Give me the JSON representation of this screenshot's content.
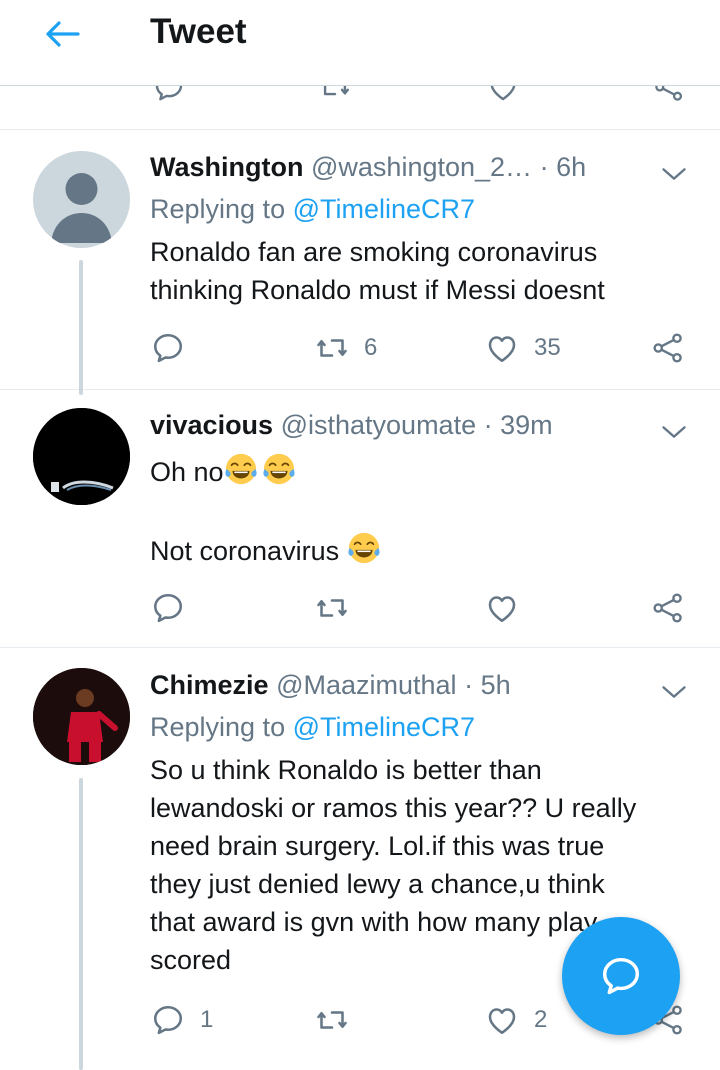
{
  "header": {
    "title": "Tweet",
    "back_icon": "arrow-left-icon",
    "accent": "#1da1f2"
  },
  "tweets": [
    {
      "name": "Washington",
      "handle": "@washington_2…",
      "time": "6h",
      "replying_label": "Replying to",
      "replying_to": "@TimelineCR7",
      "text_lines": [
        "Ronaldo fan are smoking coronavirus",
        "thinking Ronaldo must if Messi doesnt"
      ],
      "reply_count": "",
      "retweet_count": "6",
      "like_count": "35"
    },
    {
      "name": "vivacious",
      "handle": "@isthatyoumate",
      "time": "39m",
      "text_line1": "Oh no",
      "text_line2": "Not coronavirus ",
      "emoji": "face-with-tears-of-joy",
      "reply_count": "",
      "retweet_count": "",
      "like_count": ""
    },
    {
      "name": "Chimezie",
      "handle": "@Maazimuthal",
      "time": "5h",
      "replying_label": "Replying to",
      "replying_to": "@TimelineCR7",
      "text_lines": [
        "So u think Ronaldo is better than",
        "lewandoski or ramos this year?? U really",
        "need brain surgery. Lol.if this was true",
        "they just denied lewy a chance,u think",
        "that award is gvn with how many play",
        "scored"
      ],
      "reply_count": "1",
      "retweet_count": "",
      "like_count": "2"
    }
  ],
  "fab": {
    "icon": "compose-reply-icon"
  }
}
